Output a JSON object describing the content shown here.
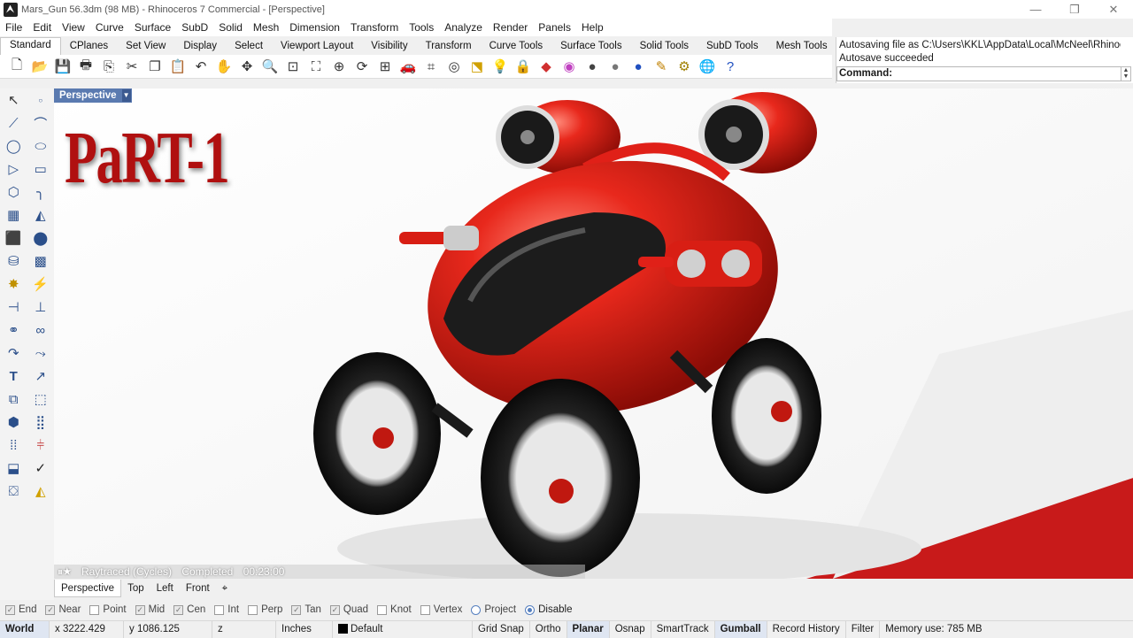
{
  "window": {
    "title": "Mars_Gun 56.3dm (98 MB) - Rhinoceros 7 Commercial - [Perspective]",
    "controls": [
      "—",
      "❐",
      "✕"
    ]
  },
  "menu": [
    "File",
    "Edit",
    "View",
    "Curve",
    "Surface",
    "SubD",
    "Solid",
    "Mesh",
    "Dimension",
    "Transform",
    "Tools",
    "Analyze",
    "Render",
    "Panels",
    "Help"
  ],
  "tabs": [
    "Standard",
    "CPlanes",
    "Set View",
    "Display",
    "Select",
    "Viewport Layout",
    "Visibility",
    "Transform",
    "Curve Tools",
    "Surface Tools",
    "Solid Tools",
    "SubD Tools",
    "Mesh Tools"
  ],
  "tabs_more": "»",
  "toolbar_icons": [
    "new-icon",
    "open-icon",
    "save-icon",
    "print-icon",
    "import-icon",
    "cut-icon",
    "copy-icon",
    "paste-icon",
    "undo-icon",
    "pan-icon",
    "move-view-icon",
    "zoom-icon",
    "zoom-window-icon",
    "zoom-extents-icon",
    "zoom-selected-icon",
    "rotate-view-icon",
    "four-view-icon",
    "car-icon",
    "grid-icon",
    "osnap-icon",
    "cplane-icon",
    "bulb-icon",
    "lock-icon",
    "layer-icon",
    "color-wheel-icon",
    "sphere-icon",
    "shaded-sphere-icon",
    "render-sphere-icon",
    "edit-icon",
    "gear-settings-icon",
    "globe-icon",
    "help-icon"
  ],
  "command": {
    "line1": "Autosaving file as C:\\Users\\KKL\\AppData\\Local\\McNeel\\Rhinoc",
    "line2": "Autosave succeeded",
    "prompt": "Command:"
  },
  "viewport": {
    "label": "Perspective",
    "overlay_text": "PaRT-1",
    "render_status": {
      "engine": "Raytraced (Cycles)",
      "state": "Completed",
      "time": "00:23:00"
    }
  },
  "view_tabs": [
    "Perspective",
    "Top",
    "Left",
    "Front"
  ],
  "osnaps": [
    {
      "label": "End",
      "checked": true
    },
    {
      "label": "Near",
      "checked": true
    },
    {
      "label": "Point",
      "checked": false
    },
    {
      "label": "Mid",
      "checked": true
    },
    {
      "label": "Cen",
      "checked": true
    },
    {
      "label": "Int",
      "checked": false
    },
    {
      "label": "Perp",
      "checked": false
    },
    {
      "label": "Tan",
      "checked": true
    },
    {
      "label": "Quad",
      "checked": true
    },
    {
      "label": "Knot",
      "checked": false
    },
    {
      "label": "Vertex",
      "checked": false
    }
  ],
  "osnap_project": "Project",
  "osnap_disable": "Disable",
  "status": {
    "cplane": "World",
    "x": "x 3222.429",
    "y": "y 1086.125",
    "z": "z",
    "units": "Inches",
    "layer": "Default",
    "grid_snap": "Grid Snap",
    "ortho": "Ortho",
    "planar": "Planar",
    "osnap": "Osnap",
    "smarttrack": "SmartTrack",
    "gumball": "Gumball",
    "record_history": "Record History",
    "filter": "Filter",
    "memory": "Memory use: 785 MB"
  },
  "colors": {
    "robot_red": "#e3201a",
    "viewport_label_bg": "#5a7ab0",
    "title_red": "#b01010"
  }
}
